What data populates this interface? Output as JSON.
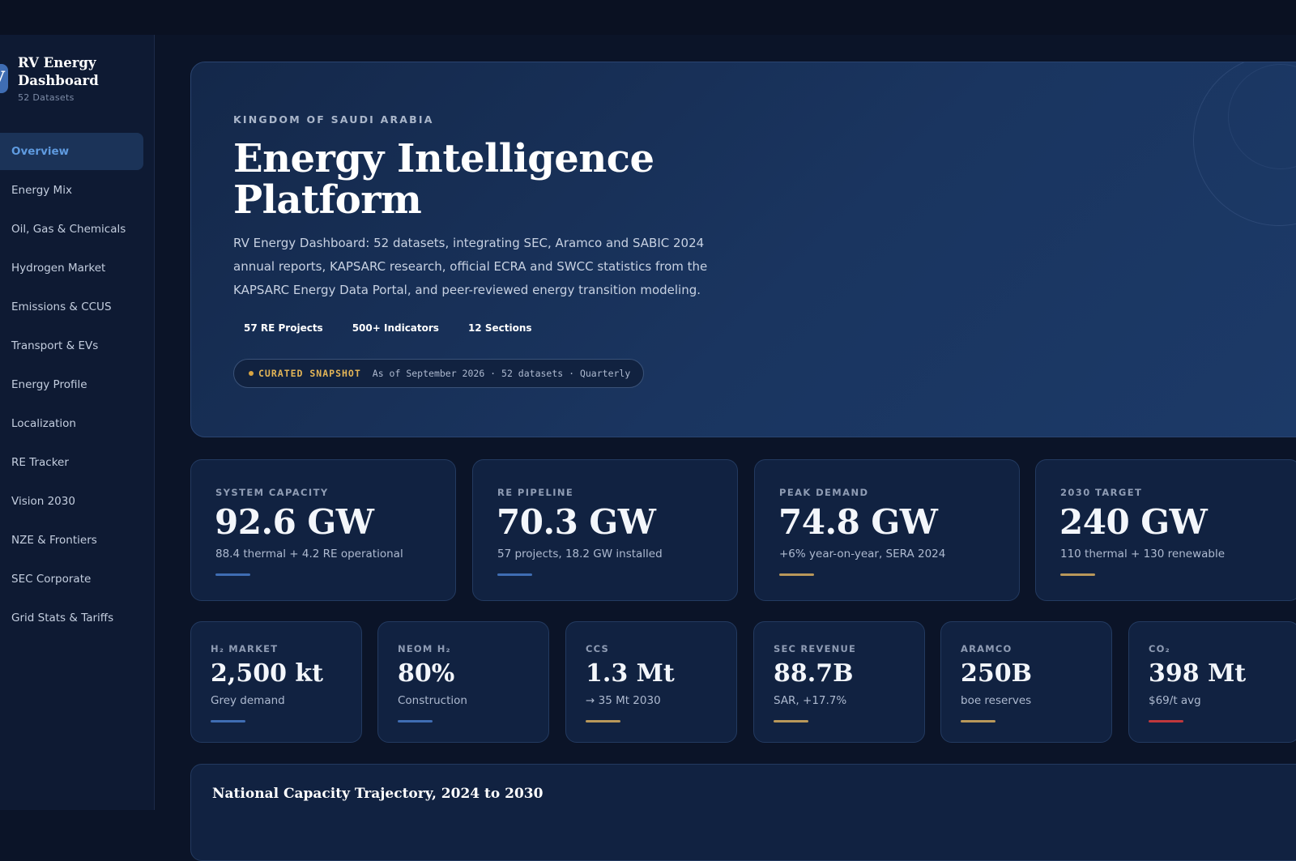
{
  "brand": {
    "logo_letter": "V",
    "title": "RV Energy Dashboard",
    "subtitle": "52 Datasets"
  },
  "nav": {
    "items": [
      {
        "label": "Overview",
        "active": true
      },
      {
        "label": "Energy Mix"
      },
      {
        "label": "Oil, Gas & Chemicals"
      },
      {
        "label": "Hydrogen Market"
      },
      {
        "label": "Emissions & CCUS"
      },
      {
        "label": "Transport & EVs"
      },
      {
        "label": "Energy Profile"
      },
      {
        "label": "Localization"
      },
      {
        "label": "RE Tracker"
      },
      {
        "label": "Vision 2030"
      },
      {
        "label": "NZE & Frontiers"
      },
      {
        "label": "SEC Corporate"
      },
      {
        "label": "Grid Stats & Tariffs"
      }
    ]
  },
  "hero": {
    "eyebrow": "KINGDOM OF SAUDI ARABIA",
    "title": "Energy Intelligence Platform",
    "description": "RV Energy Dashboard: 52 datasets, integrating SEC, Aramco and SABIC 2024 annual reports, KAPSARC research, official ECRA and SWCC statistics from the KAPSARC Energy Data Portal, and peer-reviewed energy transition modeling.",
    "tags": [
      "57 RE Projects",
      "500+ Indicators",
      "12 Sections"
    ],
    "snapshot": {
      "label": "CURATED SNAPSHOT",
      "text": "As of September 2026 · 52 datasets · Quarterly"
    }
  },
  "kpis_primary": [
    {
      "label": "SYSTEM CAPACITY",
      "value": "92.6 GW",
      "sub": "88.4 thermal + 4.2 RE operational",
      "accent": "#3f6db3"
    },
    {
      "label": "RE PIPELINE",
      "value": "70.3 GW",
      "sub": "57 projects, 18.2 GW installed",
      "accent": "#3f6db3"
    },
    {
      "label": "PEAK DEMAND",
      "value": "74.8 GW",
      "sub": "+6% year-on-year, SERA 2024",
      "accent": "#b9985a"
    },
    {
      "label": "2030 TARGET",
      "value": "240 GW",
      "sub": "110 thermal + 130 renewable",
      "accent": "#b9985a"
    }
  ],
  "kpis_secondary": [
    {
      "label": "H₂ MARKET",
      "value": "2,500 kt",
      "sub": "Grey demand",
      "accent": "#3f6db3"
    },
    {
      "label": "NEOM H₂",
      "value": "80%",
      "sub": "Construction",
      "accent": "#3f6db3"
    },
    {
      "label": "CCS",
      "value": "1.3 Mt",
      "sub": "→ 35 Mt 2030",
      "accent": "#b9985a"
    },
    {
      "label": "SEC REVENUE",
      "value": "88.7B",
      "sub": "SAR, +17.7%",
      "accent": "#b9985a"
    },
    {
      "label": "ARAMCO",
      "value": "250B",
      "sub": "boe reserves",
      "accent": "#b9985a"
    },
    {
      "label": "CO₂",
      "value": "398 Mt",
      "sub": "$69/t avg",
      "accent": "#c0383c"
    }
  ],
  "chart_section": {
    "title": "National Capacity Trajectory, 2024 to 2030"
  }
}
